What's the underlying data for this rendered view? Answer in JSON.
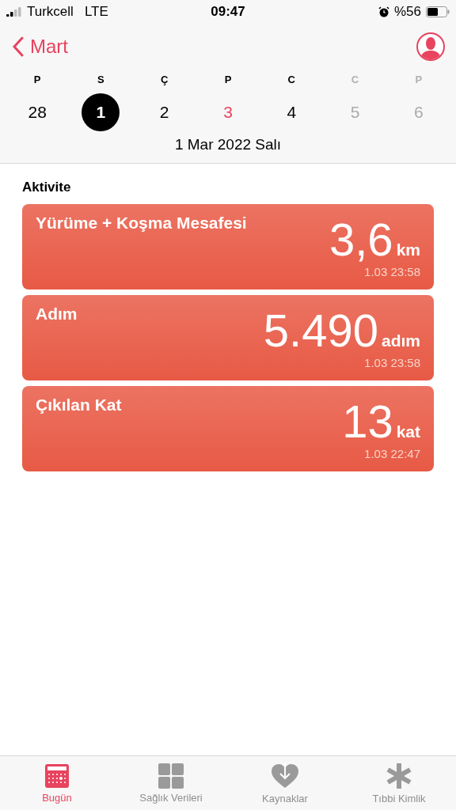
{
  "status_bar": {
    "carrier": "Turkcell",
    "network": "LTE",
    "time": "09:47",
    "battery_text": "%56"
  },
  "nav": {
    "back_label": "Mart"
  },
  "week": [
    {
      "weekday": "P",
      "day": "28",
      "selected": false,
      "kind": "past"
    },
    {
      "weekday": "S",
      "day": "1",
      "selected": true,
      "kind": "past"
    },
    {
      "weekday": "Ç",
      "day": "2",
      "selected": false,
      "kind": "past"
    },
    {
      "weekday": "P",
      "day": "3",
      "selected": false,
      "kind": "today"
    },
    {
      "weekday": "C",
      "day": "4",
      "selected": false,
      "kind": "past"
    },
    {
      "weekday": "C",
      "day": "5",
      "selected": false,
      "kind": "future"
    },
    {
      "weekday": "P",
      "day": "6",
      "selected": false,
      "kind": "future"
    }
  ],
  "selected_date": "1 Mar 2022 Salı",
  "section_title": "Aktivite",
  "cards": [
    {
      "title": "Yürüme + Koşma Mesafesi",
      "value": "3,6",
      "unit": "km",
      "timestamp": "1.03 23:58"
    },
    {
      "title": "Adım",
      "value": "5.490",
      "unit": "adım",
      "timestamp": "1.03 23:58"
    },
    {
      "title": "Çıkılan Kat",
      "value": "13",
      "unit": "kat",
      "timestamp": "1.03 22:47"
    }
  ],
  "tab_bar": [
    {
      "label": "Bugün",
      "selected": true
    },
    {
      "label": "Sağlık Verileri",
      "selected": false
    },
    {
      "label": "Kaynaklar",
      "selected": false
    },
    {
      "label": "Tıbbi Kimlik",
      "selected": false
    }
  ]
}
